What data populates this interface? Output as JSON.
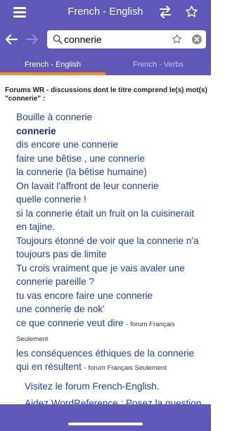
{
  "header": {
    "title": "French - English",
    "icons": [
      "menu-icon",
      "swap-icon",
      "star-icon",
      "back-arrow-icon",
      "forward-arrow-icon"
    ]
  },
  "search": {
    "value": "connerie",
    "placeholder": ""
  },
  "tabs": [
    {
      "label": "French - English",
      "active": true
    },
    {
      "label": "French - Verbs",
      "active": false
    }
  ],
  "forum": {
    "heading": "Forums WR - discussions dont le titre comprend le(s) mot(s) \"connerie\" :",
    "threads": [
      {
        "title": "Bouille à connerie",
        "note": ""
      },
      {
        "title": "connerie",
        "note": ""
      },
      {
        "title": "dis encore une connerie",
        "note": ""
      },
      {
        "title": "faire une bêtise , une connerie",
        "note": ""
      },
      {
        "title": "la connerie (la bêtise humaine)",
        "note": ""
      },
      {
        "title": "On lavait l'affront de leur connerie",
        "note": ""
      },
      {
        "title": "quelle connerie !",
        "note": ""
      },
      {
        "title": "si la connerie était un fruit on la cuisinerait en tajine.",
        "note": ""
      },
      {
        "title": "Toujours étonné de voir que la connerie n'a toujours pas de limite",
        "note": ""
      },
      {
        "title": "Tu crois vraiment que je vais avaler une connerie pareille ?",
        "note": ""
      },
      {
        "title": "tu vas encore faire une connerie",
        "note": ""
      },
      {
        "title": "une connerie de nok'",
        "note": ""
      },
      {
        "title": "ce que connerie veut dire",
        "note": "- forum Français Seulement"
      },
      {
        "title": "les conséquences éthiques de la connerie qui en résultent",
        "note": "- forum Français Seulement"
      }
    ],
    "visit_link": "Visitez le forum French-English.",
    "help_text": "Aidez WordReference : Posez la question"
  },
  "colors": {
    "header_bg": "#5f58b8",
    "tab_indicator": "#ff8a1d",
    "link": "#1c3ea6"
  }
}
